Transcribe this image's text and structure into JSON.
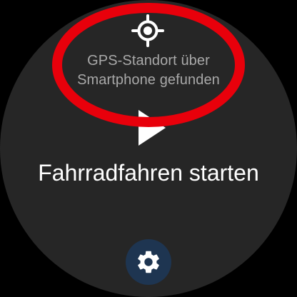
{
  "gps": {
    "icon": "gps-location-icon",
    "status_line1": "GPS-Standort über",
    "status_line2": "Smartphone gefunden"
  },
  "activity": {
    "play_icon": "play-icon",
    "start_label": "Fahrradfahren starten"
  },
  "settings": {
    "icon": "gear-icon"
  },
  "colors": {
    "background": "#262626",
    "status_text": "#a9a9a9",
    "primary_text": "#ffffff",
    "settings_button": "#1e3551",
    "annotation": "#e8000b"
  }
}
